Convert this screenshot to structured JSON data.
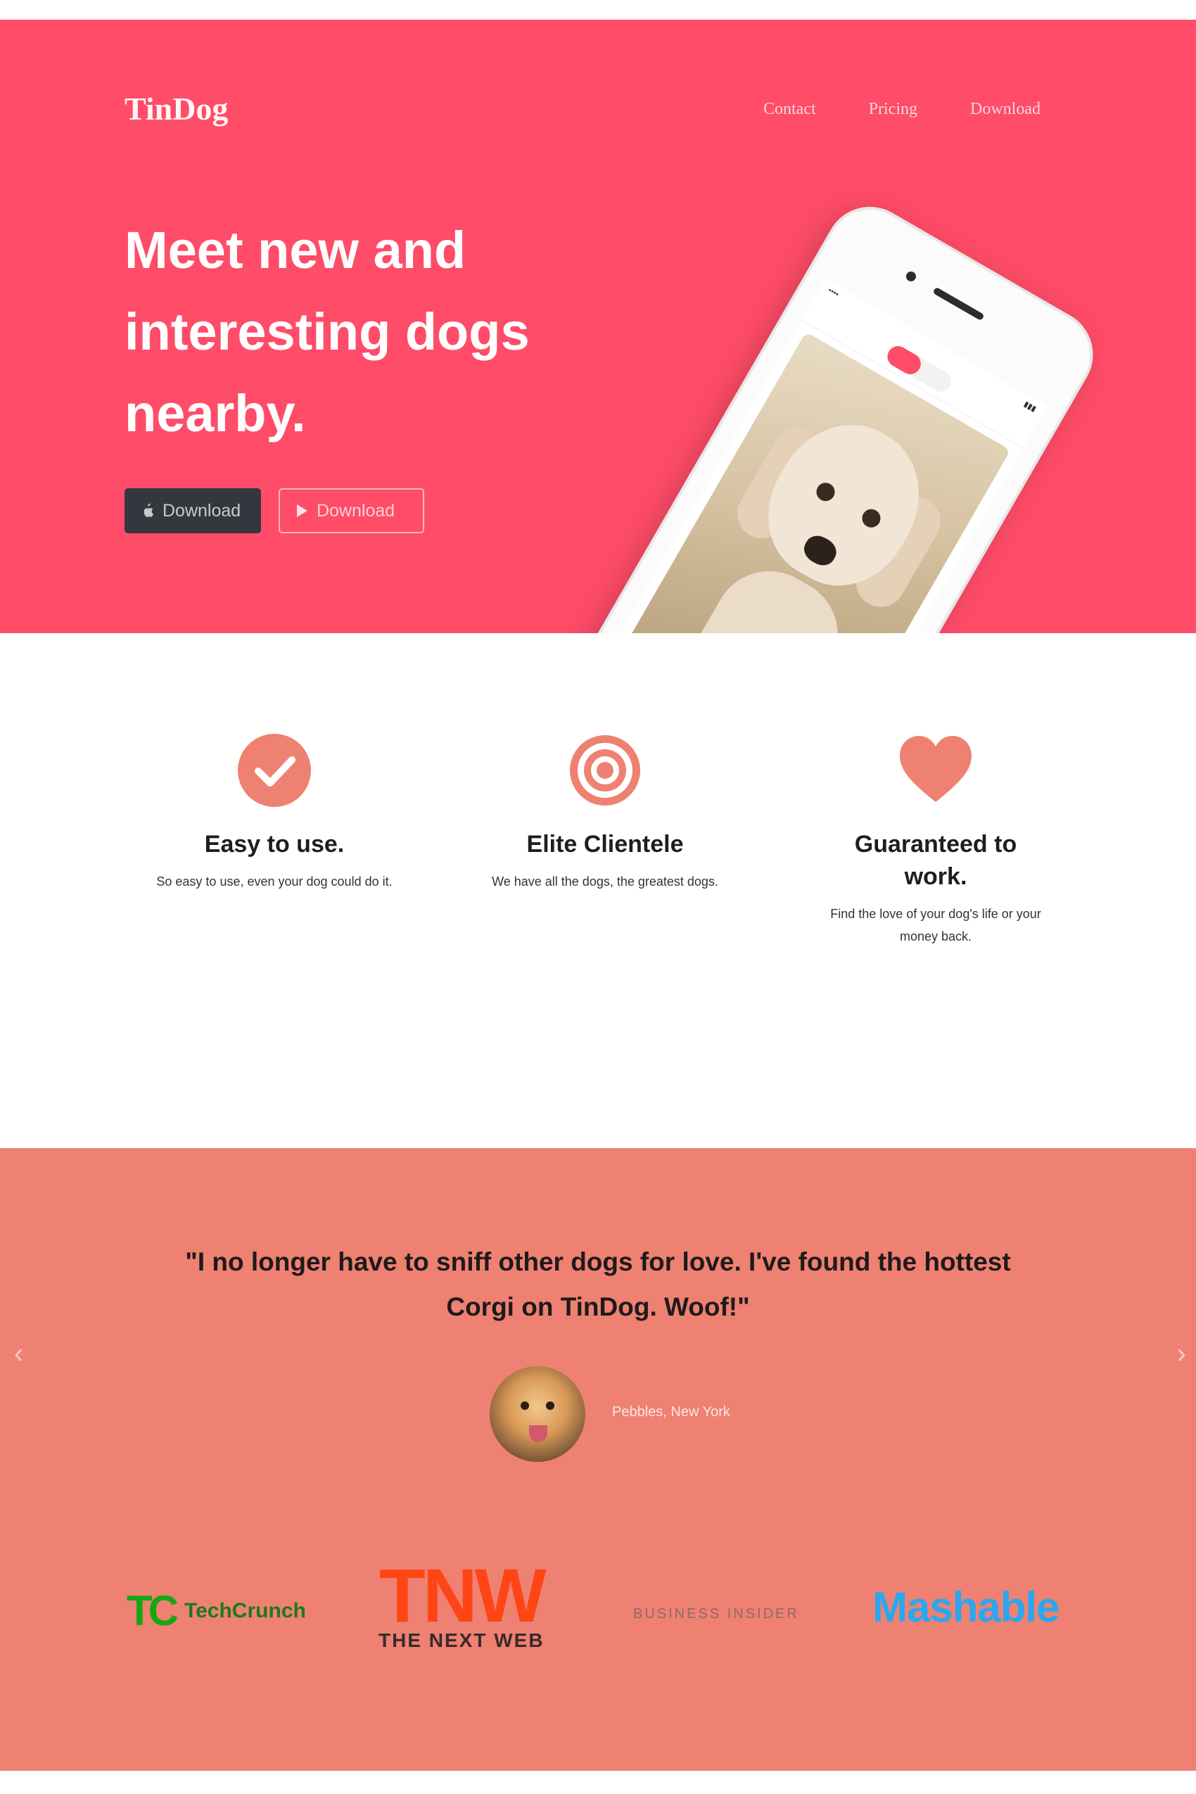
{
  "header": {
    "brand": "TinDog",
    "nav": [
      "Contact",
      "Pricing",
      "Download"
    ]
  },
  "hero": {
    "headline": "Meet new and interesting dogs nearby.",
    "buttons": [
      {
        "label": "Download",
        "icon": "apple-icon"
      },
      {
        "label": "Download",
        "icon": "play-icon"
      }
    ]
  },
  "features": [
    {
      "title": "Easy to use.",
      "text": "So easy to use, even your dog could do it.",
      "icon": "check-circle-icon"
    },
    {
      "title": "Elite Clientele",
      "text": "We have all the dogs, the greatest dogs.",
      "icon": "bullseye-icon"
    },
    {
      "title": "Guaranteed to work.",
      "text": "Find the love of your dog's life or your money back.",
      "icon": "heart-icon"
    }
  ],
  "testimonial": {
    "quote": "\"I no longer have to sniff other dogs for love. I've found the hottest Corgi on TinDog. Woof!\"",
    "author": "Pebbles, New York"
  },
  "press": {
    "techcrunch": {
      "mark": "TC",
      "word": "TechCrunch"
    },
    "tnw": {
      "mark": "TNW",
      "word": "THE NEXT WEB"
    },
    "business_insider": "BUSINESS INSIDER",
    "mashable": "Mashable"
  },
  "colors": {
    "hero_bg": "#ff4c68",
    "testimonial_bg": "#ee8172",
    "icon": "#ef8172"
  }
}
